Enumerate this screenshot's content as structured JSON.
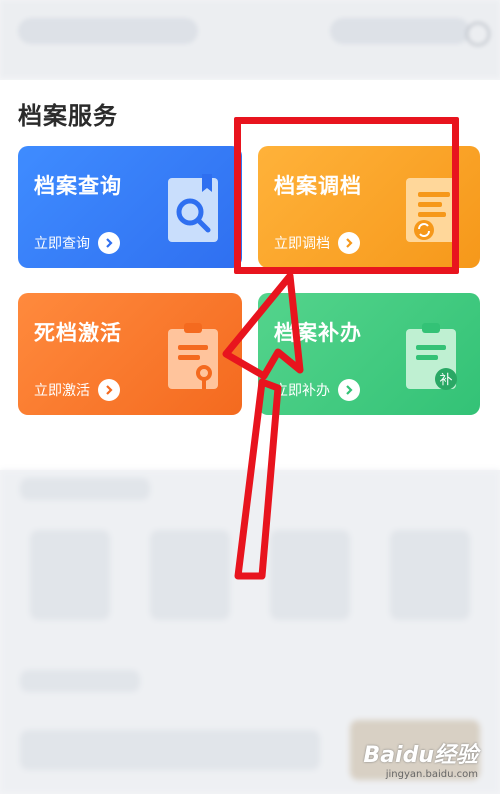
{
  "section": {
    "title": "档案服务"
  },
  "cards": [
    {
      "title": "档案查询",
      "action": "立即查询"
    },
    {
      "title": "档案调档",
      "action": "立即调档"
    },
    {
      "title": "死档激活",
      "action": "立即激活"
    },
    {
      "title": "档案补办",
      "action": "立即补办",
      "badge": "补"
    }
  ],
  "watermark": {
    "logo": "Baidu经验",
    "url": "jingyan.baidu.com"
  },
  "colors": {
    "blue": "#2f6ff0",
    "orange": "#f6981a",
    "red": "#f46a1f",
    "green": "#33c276",
    "highlight": "#e8141e"
  }
}
